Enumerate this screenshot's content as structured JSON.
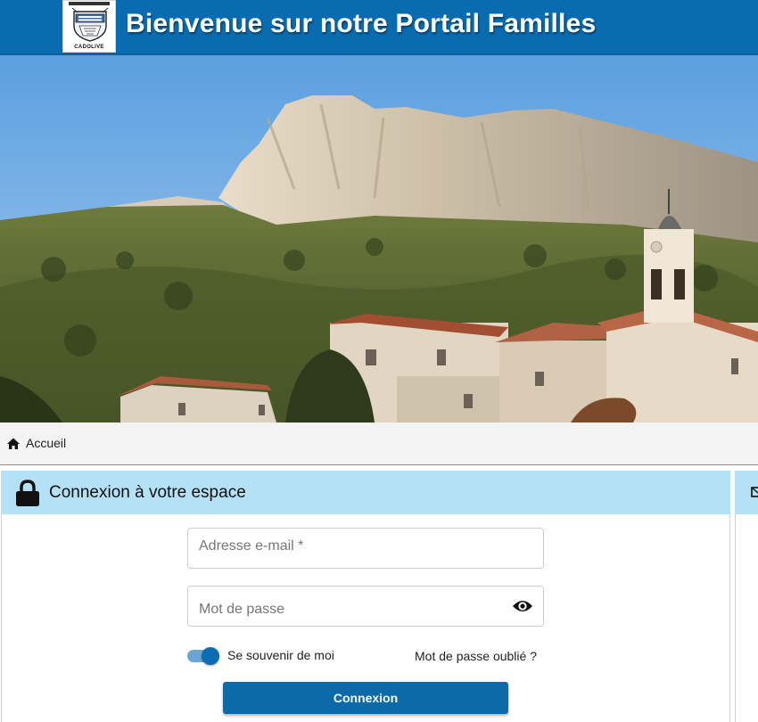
{
  "header": {
    "title": "Bienvenue sur notre Portail Familles",
    "logo_text": "CADOLIVE",
    "brand_color": "#0a6cb0"
  },
  "hero": {
    "image": "village-hillside-photo"
  },
  "breadcrumb": {
    "home_icon": "home-icon",
    "label": "Accueil"
  },
  "login": {
    "icon": "lock-icon",
    "title": "Connexion à votre espace",
    "header_color": "#b4e1f6",
    "email": {
      "placeholder": "Adresse e-mail *",
      "value": ""
    },
    "password": {
      "placeholder": "Mot de passe",
      "value": "",
      "toggle_icon": "eye-icon"
    },
    "remember": {
      "label": "Se souvenir de moi",
      "checked": true
    },
    "forgot_label": "Mot de passe oublié ?",
    "submit_label": "Connexion",
    "button_color": "#0c6aa8"
  },
  "side_panel": {
    "icon": "mail-icon"
  }
}
